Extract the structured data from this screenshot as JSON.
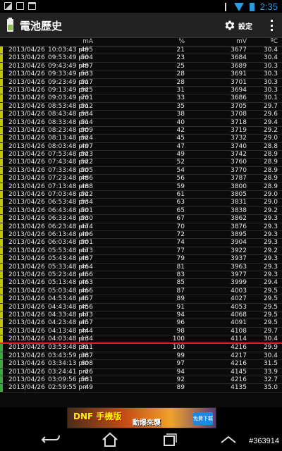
{
  "status_bar": {
    "time": "2:35"
  },
  "app": {
    "title": "電池歷史",
    "settings_label": "設定"
  },
  "columns": {
    "ma": "mA",
    "pct": "%",
    "mv": "mV",
    "temp": "ºC"
  },
  "rows": [
    {
      "date": "2013/04/26",
      "time": "10:03:43 pm",
      "ma": "-495",
      "pct": "21",
      "mv": "3677",
      "temp": "30.4",
      "state": "discharging"
    },
    {
      "date": "2013/04/26",
      "time": "09:53:49 pm",
      "ma": "-504",
      "pct": "23",
      "mv": "3684",
      "temp": "30.4",
      "state": "discharging"
    },
    {
      "date": "2013/04/26",
      "time": "09:43:49 pm",
      "ma": "-497",
      "pct": "25",
      "mv": "3689",
      "temp": "30.3",
      "state": "discharging"
    },
    {
      "date": "2013/04/26",
      "time": "09:33:49 pm",
      "ma": "-533",
      "pct": "28",
      "mv": "3691",
      "temp": "30.3",
      "state": "discharging"
    },
    {
      "date": "2013/04/26",
      "time": "09:23:49 pm",
      "ma": "-517",
      "pct": "28",
      "mv": "3701",
      "temp": "30.3",
      "state": "discharging"
    },
    {
      "date": "2013/04/26",
      "time": "09:13:49 pm",
      "ma": "-525",
      "pct": "31",
      "mv": "3694",
      "temp": "30.3",
      "state": "discharging"
    },
    {
      "date": "2013/04/26",
      "time": "09:03:49 pm",
      "ma": "-701",
      "pct": "33",
      "mv": "3686",
      "temp": "30.1",
      "state": "discharging"
    },
    {
      "date": "2013/04/26",
      "time": "08:53:48 pm",
      "ma": "-512",
      "pct": "35",
      "mv": "3705",
      "temp": "29.7",
      "state": "discharging"
    },
    {
      "date": "2013/04/26",
      "time": "08:43:48 pm",
      "ma": "-534",
      "pct": "38",
      "mv": "3708",
      "temp": "29.6",
      "state": "discharging"
    },
    {
      "date": "2013/04/26",
      "time": "08:33:48 pm",
      "ma": "-514",
      "pct": "40",
      "mv": "3718",
      "temp": "29.4",
      "state": "discharging"
    },
    {
      "date": "2013/04/26",
      "time": "08:23:48 pm",
      "ma": "-509",
      "pct": "42",
      "mv": "3719",
      "temp": "29.2",
      "state": "discharging"
    },
    {
      "date": "2013/04/26",
      "time": "08:13:48 pm",
      "ma": "-524",
      "pct": "45",
      "mv": "3732",
      "temp": "29.0",
      "state": "discharging"
    },
    {
      "date": "2013/04/26",
      "time": "08:03:48 pm",
      "ma": "-497",
      "pct": "47",
      "mv": "3740",
      "temp": "28.8",
      "state": "discharging"
    },
    {
      "date": "2013/04/26",
      "time": "07:53:48 pm",
      "ma": "-523",
      "pct": "49",
      "mv": "3742",
      "temp": "28.9",
      "state": "discharging"
    },
    {
      "date": "2013/04/26",
      "time": "07:43:48 pm",
      "ma": "-522",
      "pct": "52",
      "mv": "3760",
      "temp": "28.9",
      "state": "discharging"
    },
    {
      "date": "2013/04/26",
      "time": "07:33:48 pm",
      "ma": "-505",
      "pct": "54",
      "mv": "3770",
      "temp": "28.9",
      "state": "discharging"
    },
    {
      "date": "2013/04/26",
      "time": "07:23:48 pm",
      "ma": "-486",
      "pct": "56",
      "mv": "3787",
      "temp": "28.9",
      "state": "discharging"
    },
    {
      "date": "2013/04/26",
      "time": "07:13:48 pm",
      "ma": "-488",
      "pct": "59",
      "mv": "3800",
      "temp": "28.9",
      "state": "discharging"
    },
    {
      "date": "2013/04/26",
      "time": "07:03:48 pm",
      "ma": "-522",
      "pct": "61",
      "mv": "3805",
      "temp": "29.0",
      "state": "discharging"
    },
    {
      "date": "2013/04/26",
      "time": "06:53:48 pm",
      "ma": "-534",
      "pct": "63",
      "mv": "3831",
      "temp": "29.0",
      "state": "discharging"
    },
    {
      "date": "2013/04/26",
      "time": "06:43:48 pm",
      "ma": "-501",
      "pct": "65",
      "mv": "3838",
      "temp": "29.2",
      "state": "discharging"
    },
    {
      "date": "2013/04/26",
      "time": "06:33:48 pm",
      "ma": "-530",
      "pct": "67",
      "mv": "3862",
      "temp": "29.3",
      "state": "discharging"
    },
    {
      "date": "2013/04/26",
      "time": "06:23:48 pm",
      "ma": "-474",
      "pct": "70",
      "mv": "3876",
      "temp": "29.3",
      "state": "discharging"
    },
    {
      "date": "2013/04/26",
      "time": "06:13:48 pm",
      "ma": "-496",
      "pct": "72",
      "mv": "3895",
      "temp": "29.3",
      "state": "discharging"
    },
    {
      "date": "2013/04/26",
      "time": "06:03:48 pm",
      "ma": "-501",
      "pct": "74",
      "mv": "3904",
      "temp": "29.3",
      "state": "discharging"
    },
    {
      "date": "2013/04/26",
      "time": "05:53:48 pm",
      "ma": "-473",
      "pct": "77",
      "mv": "3922",
      "temp": "29.2",
      "state": "discharging"
    },
    {
      "date": "2013/04/26",
      "time": "05:43:48 pm",
      "ma": "-487",
      "pct": "79",
      "mv": "3937",
      "temp": "29.3",
      "state": "discharging"
    },
    {
      "date": "2013/04/26",
      "time": "05:33:48 pm",
      "ma": "-464",
      "pct": "81",
      "mv": "3963",
      "temp": "29.3",
      "state": "discharging"
    },
    {
      "date": "2013/04/26",
      "time": "05:23:48 pm",
      "ma": "-456",
      "pct": "83",
      "mv": "3977",
      "temp": "29.3",
      "state": "discharging"
    },
    {
      "date": "2013/04/26",
      "time": "05:13:48 pm",
      "ma": "-463",
      "pct": "85",
      "mv": "3999",
      "temp": "29.4",
      "state": "discharging"
    },
    {
      "date": "2013/04/26",
      "time": "05:03:48 pm",
      "ma": "-466",
      "pct": "87",
      "mv": "4003",
      "temp": "29.5",
      "state": "discharging"
    },
    {
      "date": "2013/04/26",
      "time": "04:53:48 pm",
      "ma": "-457",
      "pct": "89",
      "mv": "4027",
      "temp": "29.5",
      "state": "discharging"
    },
    {
      "date": "2013/04/26",
      "time": "04:43:48 pm",
      "ma": "-456",
      "pct": "91",
      "mv": "4053",
      "temp": "29.5",
      "state": "discharging"
    },
    {
      "date": "2013/04/26",
      "time": "04:33:48 pm",
      "ma": "-473",
      "pct": "94",
      "mv": "4068",
      "temp": "29.5",
      "state": "discharging"
    },
    {
      "date": "2013/04/26",
      "time": "04:23:48 pm",
      "ma": "-457",
      "pct": "96",
      "mv": "4091",
      "temp": "29.5",
      "state": "discharging"
    },
    {
      "date": "2013/04/26",
      "time": "04:13:48 pm",
      "ma": "-444",
      "pct": "98",
      "mv": "4108",
      "temp": "29.7",
      "state": "discharging"
    },
    {
      "date": "2013/04/26",
      "time": "04:03:48 pm",
      "ma": "-134",
      "pct": "100",
      "mv": "4114",
      "temp": "30.4",
      "state": "discharging"
    },
    {
      "date": "2013/04/26",
      "time": "03:53:48 pm",
      "ma": "311",
      "pct": "100",
      "mv": "4216",
      "temp": "29.9",
      "state": "charging"
    },
    {
      "date": "2013/04/26",
      "time": "03:43:59 pm",
      "ma": "387",
      "pct": "99",
      "mv": "4217",
      "temp": "30.4",
      "state": "charging"
    },
    {
      "date": "2013/04/26",
      "time": "03:34:13 pm",
      "ma": "608",
      "pct": "97",
      "mv": "4216",
      "temp": "31.5",
      "state": "charging"
    },
    {
      "date": "2013/04/26",
      "time": "03:24:41 pm",
      "ma": "-26",
      "pct": "94",
      "mv": "4145",
      "temp": "33.9",
      "state": "charging"
    },
    {
      "date": "2013/04/26",
      "time": "03:09:56 pm",
      "ma": "581",
      "pct": "92",
      "mv": "4216",
      "temp": "32.7",
      "state": "charging"
    },
    {
      "date": "2013/04/26",
      "time": "02:59:55 pm",
      "ma": "-49",
      "pct": "89",
      "mv": "4135",
      "temp": "35.0",
      "state": "charging"
    }
  ],
  "ad": {
    "title": "DNF 手機版",
    "subtitle": "動爆來襲",
    "button": "免費下載"
  },
  "watermark": "#363914",
  "colors": {
    "discharging": "#c4c500",
    "charging": "#3fa93f",
    "divider": "#e0241b",
    "accent": "#2a9be0"
  }
}
